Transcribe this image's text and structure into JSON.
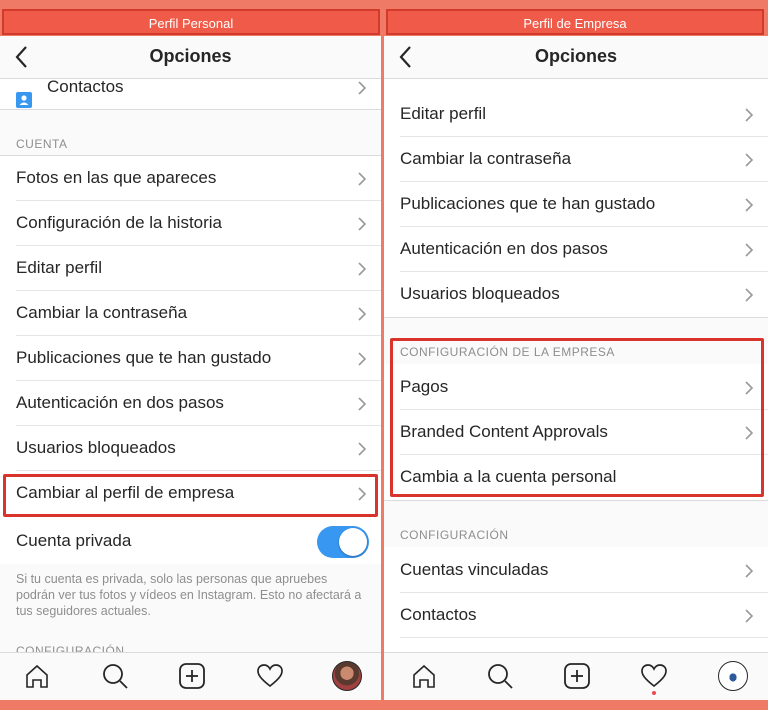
{
  "left": {
    "banner": "Perfil Personal",
    "title": "Opciones",
    "contacts_label": "Contactos",
    "section_account": "CUENTA",
    "items": [
      {
        "label": "Fotos en las que apareces"
      },
      {
        "label": "Configuración de la historia"
      },
      {
        "label": "Editar perfil"
      },
      {
        "label": "Cambiar la contraseña"
      },
      {
        "label": "Publicaciones que te han gustado"
      },
      {
        "label": "Autenticación en dos pasos"
      },
      {
        "label": "Usuarios bloqueados"
      },
      {
        "label": "Cambiar al perfil de empresa"
      }
    ],
    "private_label": "Cuenta privada",
    "private_on": true,
    "private_note": "Si tu cuenta es privada, solo las personas que apruebes podrán ver tus fotos y vídeos en Instagram. Esto no afectará a tus seguidores actuales.",
    "section_config": "CONFIGURACIÓN"
  },
  "right": {
    "banner": "Perfil de Empresa",
    "title": "Opciones",
    "items": [
      {
        "label": "Editar perfil"
      },
      {
        "label": "Cambiar la contraseña"
      },
      {
        "label": "Publicaciones que te han gustado"
      },
      {
        "label": "Autenticación en dos pasos"
      },
      {
        "label": "Usuarios bloqueados"
      }
    ],
    "section_business": "CONFIGURACIÓN DE LA EMPRESA",
    "business_items": [
      {
        "label": "Pagos"
      },
      {
        "label": "Branded Content Approvals"
      },
      {
        "label": "Cambia a la cuenta personal"
      }
    ],
    "section_config": "CONFIGURACIÓN",
    "config_items": [
      {
        "label": "Cuentas vinculadas"
      },
      {
        "label": "Contactos"
      }
    ]
  },
  "icons": {
    "back": "chevron-left-icon",
    "row": "chevron-right-icon",
    "tabs": [
      "home-icon",
      "search-icon",
      "add-icon",
      "heart-icon",
      "profile-avatar"
    ]
  },
  "colors": {
    "background": "#ef7a66",
    "banner": "#ef5b48",
    "highlight": "#d9342b",
    "toggle": "#3897f0"
  }
}
